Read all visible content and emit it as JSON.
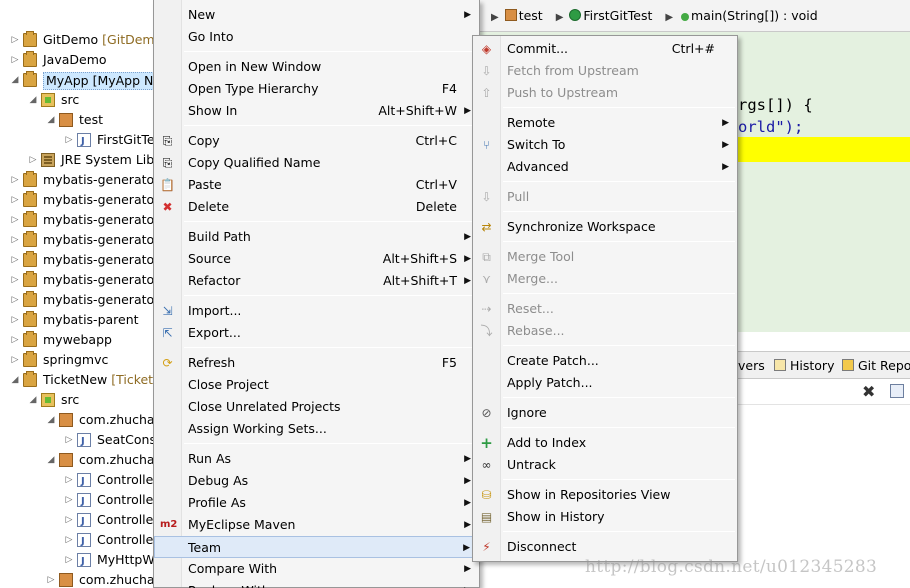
{
  "explorer": {
    "rows": [
      {
        "label": "GitDemo",
        "deco": " [GitDemo"
      },
      {
        "label": "JavaDemo",
        "deco": ""
      },
      {
        "label": "MyApp [MyApp N",
        "deco": ""
      },
      {
        "label": "src",
        "deco": ""
      },
      {
        "label": "test",
        "deco": ""
      },
      {
        "label": "FirstGitTe",
        "deco": ""
      },
      {
        "label": "JRE System Libr",
        "deco": ""
      },
      {
        "label": "mybatis-generator",
        "deco": ""
      },
      {
        "label": "mybatis-generator",
        "deco": ""
      },
      {
        "label": "mybatis-generator",
        "deco": ""
      },
      {
        "label": "mybatis-generator",
        "deco": ""
      },
      {
        "label": "mybatis-generator",
        "deco": ""
      },
      {
        "label": "mybatis-generator",
        "deco": ""
      },
      {
        "label": "mybatis-generator",
        "deco": ""
      },
      {
        "label": "mybatis-parent",
        "deco": ""
      },
      {
        "label": "mywebapp",
        "deco": ""
      },
      {
        "label": "springmvc",
        "deco": ""
      },
      {
        "label": "TicketNew",
        "deco": " [TicketN"
      },
      {
        "label": "src",
        "deco": ""
      },
      {
        "label": "com.zhucha",
        "deco": ""
      },
      {
        "label": "SeatCons",
        "deco": ""
      },
      {
        "label": "com.zhucha",
        "deco": ""
      },
      {
        "label": "Controlle",
        "deco": ""
      },
      {
        "label": "Controlle",
        "deco": ""
      },
      {
        "label": "Controlle",
        "deco": ""
      },
      {
        "label": "Controlle",
        "deco": ""
      },
      {
        "label": "MyHttpW",
        "deco": ""
      },
      {
        "label": "com.zhucha",
        "deco": ""
      }
    ]
  },
  "editor": {
    "breadcrumb": {
      "package": "test",
      "class": "FirstGitTest",
      "method": "main(String[]) : void"
    },
    "code_line_1": "rgs[]) {",
    "code_line_2": "orld\");"
  },
  "views": {
    "tab_1": "vers",
    "tab_2": "History",
    "tab_3": "Git Repo"
  },
  "context_menu": {
    "items": [
      {
        "label": "New",
        "accel": "",
        "submenu": true
      },
      {
        "label": "Go Into",
        "accel": "",
        "submenu": false
      },
      {
        "label": "Open in New Window",
        "accel": "",
        "submenu": false
      },
      {
        "label": "Open Type Hierarchy",
        "accel": "F4",
        "submenu": false
      },
      {
        "label": "Show In",
        "accel": "Alt+Shift+W",
        "submenu": true
      },
      {
        "label": "Copy",
        "accel": "Ctrl+C",
        "submenu": false
      },
      {
        "label": "Copy Qualified Name",
        "accel": "",
        "submenu": false
      },
      {
        "label": "Paste",
        "accel": "Ctrl+V",
        "submenu": false
      },
      {
        "label": "Delete",
        "accel": "Delete",
        "submenu": false
      },
      {
        "label": "Build Path",
        "accel": "",
        "submenu": true
      },
      {
        "label": "Source",
        "accel": "Alt+Shift+S",
        "submenu": true
      },
      {
        "label": "Refactor",
        "accel": "Alt+Shift+T",
        "submenu": true
      },
      {
        "label": "Import...",
        "accel": "",
        "submenu": false
      },
      {
        "label": "Export...",
        "accel": "",
        "submenu": false
      },
      {
        "label": "Refresh",
        "accel": "F5",
        "submenu": false
      },
      {
        "label": "Close Project",
        "accel": "",
        "submenu": false
      },
      {
        "label": "Close Unrelated Projects",
        "accel": "",
        "submenu": false
      },
      {
        "label": "Assign Working Sets...",
        "accel": "",
        "submenu": false
      },
      {
        "label": "Run As",
        "accel": "",
        "submenu": true
      },
      {
        "label": "Debug As",
        "accel": "",
        "submenu": true
      },
      {
        "label": "Profile As",
        "accel": "",
        "submenu": true
      },
      {
        "label": "MyEclipse Maven",
        "accel": "",
        "submenu": true
      },
      {
        "label": "Team",
        "accel": "",
        "submenu": true
      },
      {
        "label": "Compare With",
        "accel": "",
        "submenu": true
      },
      {
        "label": "Replace With",
        "accel": "",
        "submenu": true
      }
    ]
  },
  "team_menu": {
    "items": [
      {
        "label": "Commit...",
        "accel": "Ctrl+#",
        "submenu": false
      },
      {
        "label": "Fetch from Upstream",
        "accel": "",
        "submenu": false
      },
      {
        "label": "Push to Upstream",
        "accel": "",
        "submenu": false
      },
      {
        "label": "Remote",
        "accel": "",
        "submenu": true
      },
      {
        "label": "Switch To",
        "accel": "",
        "submenu": true
      },
      {
        "label": "Advanced",
        "accel": "",
        "submenu": true
      },
      {
        "label": "Pull",
        "accel": "",
        "submenu": false
      },
      {
        "label": "Synchronize Workspace",
        "accel": "",
        "submenu": false
      },
      {
        "label": "Merge Tool",
        "accel": "",
        "submenu": false
      },
      {
        "label": "Merge...",
        "accel": "",
        "submenu": false
      },
      {
        "label": "Reset...",
        "accel": "",
        "submenu": false
      },
      {
        "label": "Rebase...",
        "accel": "",
        "submenu": false
      },
      {
        "label": "Create Patch...",
        "accel": "",
        "submenu": false
      },
      {
        "label": "Apply Patch...",
        "accel": "",
        "submenu": false
      },
      {
        "label": "Ignore",
        "accel": "",
        "submenu": false
      },
      {
        "label": "Add to Index",
        "accel": "",
        "submenu": false
      },
      {
        "label": "Untrack",
        "accel": "",
        "submenu": false
      },
      {
        "label": "Show in Repositories View",
        "accel": "",
        "submenu": false
      },
      {
        "label": "Show in History",
        "accel": "",
        "submenu": false
      },
      {
        "label": "Disconnect",
        "accel": "",
        "submenu": false
      }
    ]
  },
  "watermark": "http://blog.csdn.net/u012345283",
  "colors": {
    "menu_bg": "#f5f5f5",
    "menu_hover": "#dfeaf8",
    "editor_bg": "#e4f1e0",
    "highlight": "#ffff00",
    "disabled_text": "#8d8d8d"
  }
}
